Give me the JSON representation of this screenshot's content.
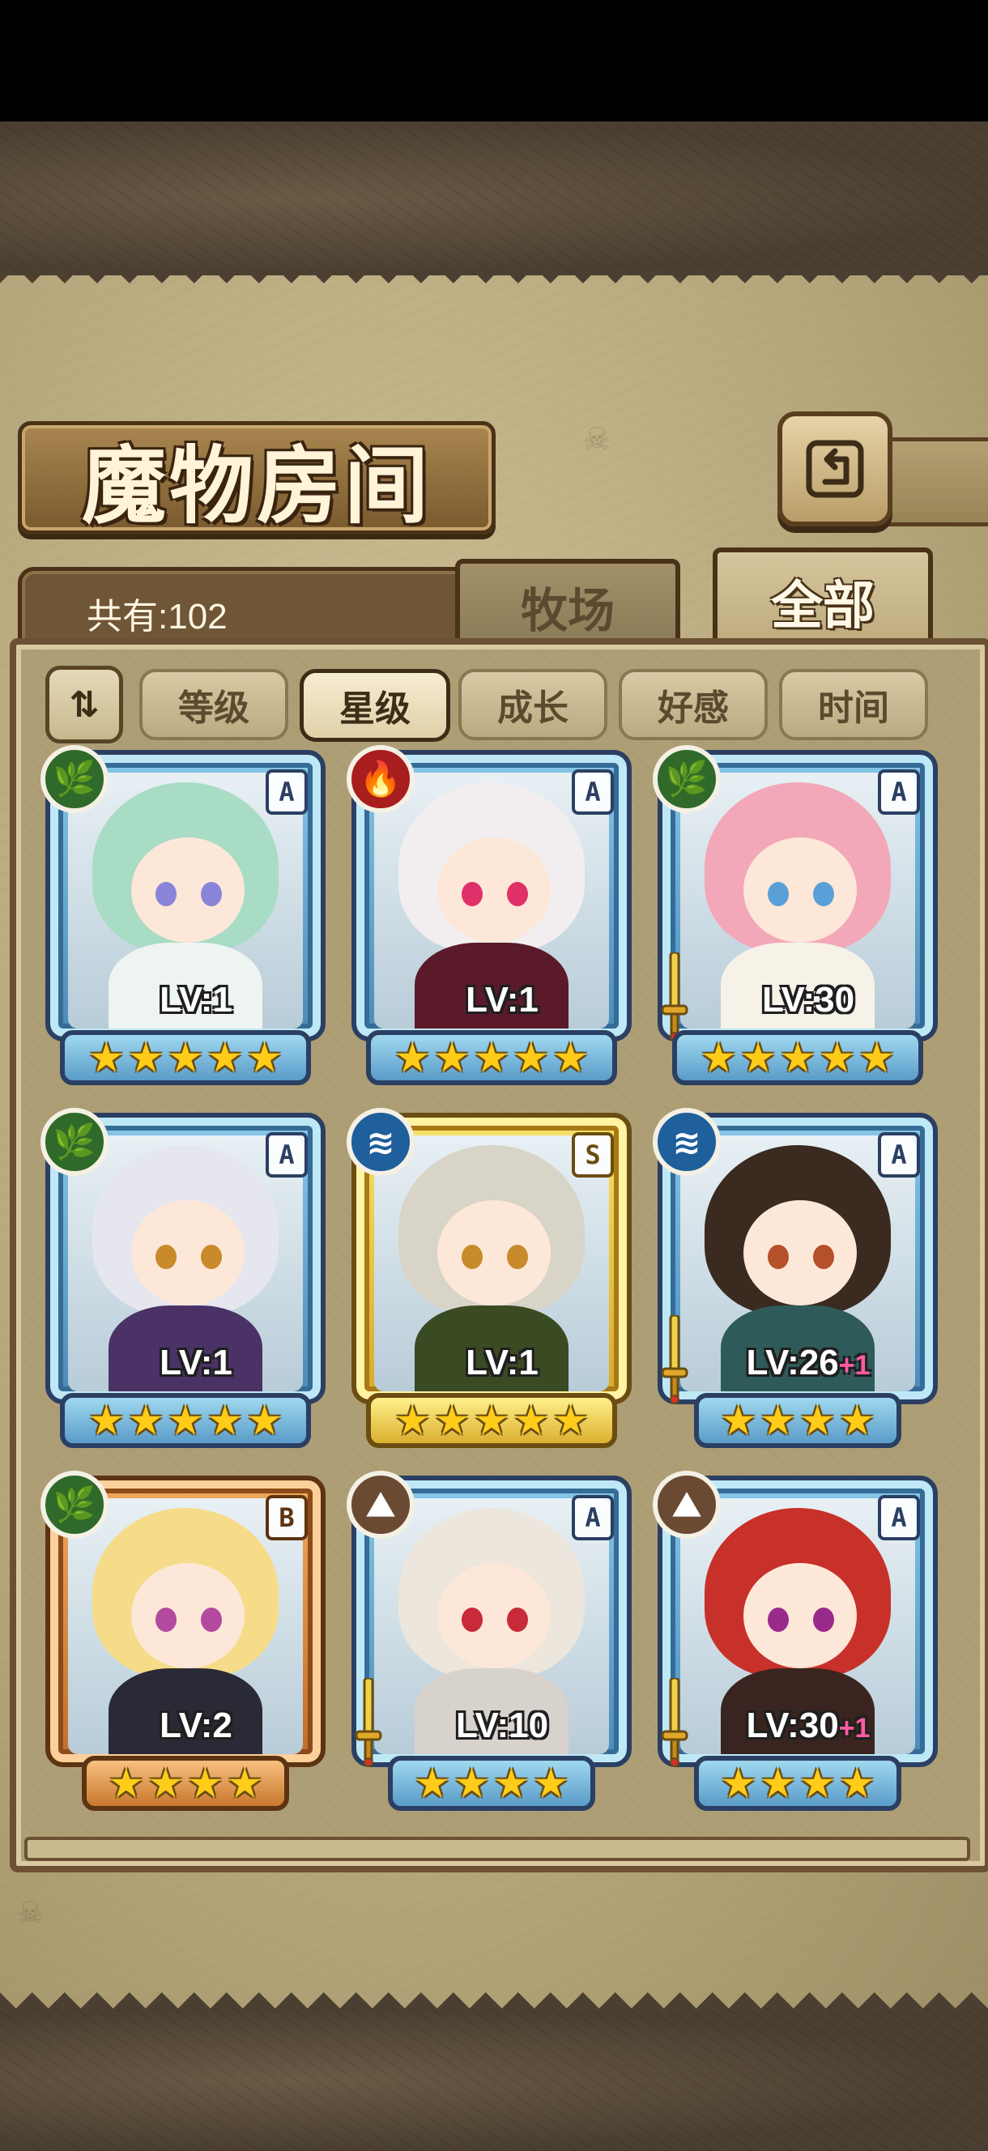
{
  "page": {
    "title": "魔物房间"
  },
  "header": {
    "count_text": "共有:102"
  },
  "tabs": [
    {
      "label": "牧场",
      "active": false
    },
    {
      "label": "全部",
      "active": true
    }
  ],
  "sort": {
    "toggle_icon": "sort-direction-icon",
    "buttons": [
      {
        "label": "等级",
        "active": false
      },
      {
        "label": "星级",
        "active": true
      },
      {
        "label": "成长",
        "active": false
      },
      {
        "label": "好感",
        "active": false
      },
      {
        "label": "时间",
        "active": false
      }
    ]
  },
  "monsters": [
    {
      "level": "LV:1",
      "bonus": "",
      "rank": "A",
      "element": "nature",
      "stars": 5,
      "sword": false,
      "colors": {
        "hair": "#a8dcc4",
        "body": "#eef4f2",
        "eye": "#8a84d8"
      }
    },
    {
      "level": "LV:1",
      "bonus": "",
      "rank": "A",
      "element": "fire",
      "stars": 5,
      "sword": false,
      "colors": {
        "hair": "#f2eef0",
        "body": "#5a1a2a",
        "eye": "#e0306a"
      }
    },
    {
      "level": "LV:30",
      "bonus": "",
      "rank": "A",
      "element": "nature",
      "stars": 5,
      "sword": true,
      "colors": {
        "hair": "#f2a8b8",
        "body": "#f7f2e8",
        "eye": "#5aa0d8"
      }
    },
    {
      "level": "LV:1",
      "bonus": "",
      "rank": "A",
      "element": "nature",
      "stars": 5,
      "sword": false,
      "colors": {
        "hair": "#e6e6ee",
        "body": "#4a3266",
        "eye": "#c88a2a"
      }
    },
    {
      "level": "LV:1",
      "bonus": "",
      "rank": "S",
      "element": "water",
      "stars": 5,
      "sword": false,
      "colors": {
        "hair": "#d8d4c8",
        "body": "#3a4a22",
        "eye": "#c88a2a"
      }
    },
    {
      "level": "LV:26",
      "bonus": "+1",
      "rank": "A",
      "element": "water",
      "stars": 4,
      "sword": true,
      "colors": {
        "hair": "#3a2a20",
        "body": "#2f5a5a",
        "eye": "#b4502a"
      }
    },
    {
      "level": "LV:2",
      "bonus": "",
      "rank": "B",
      "element": "nature",
      "stars": 4,
      "sword": false,
      "colors": {
        "hair": "#f6dc88",
        "body": "#2a2a36",
        "eye": "#b44aa0"
      }
    },
    {
      "level": "LV:10",
      "bonus": "",
      "rank": "A",
      "element": "earth",
      "stars": 4,
      "sword": true,
      "colors": {
        "hair": "#ece6dc",
        "body": "#d8d2cc",
        "eye": "#c82a3a"
      }
    },
    {
      "level": "LV:30",
      "bonus": "+1",
      "rank": "A",
      "element": "earth",
      "stars": 4,
      "sword": true,
      "colors": {
        "hair": "#c8302a",
        "body": "#3a2420",
        "eye": "#9a2a8a"
      }
    }
  ],
  "element_icons": {
    "nature": "🌿",
    "fire": "🔥",
    "water": "≋",
    "earth": "⛰"
  }
}
